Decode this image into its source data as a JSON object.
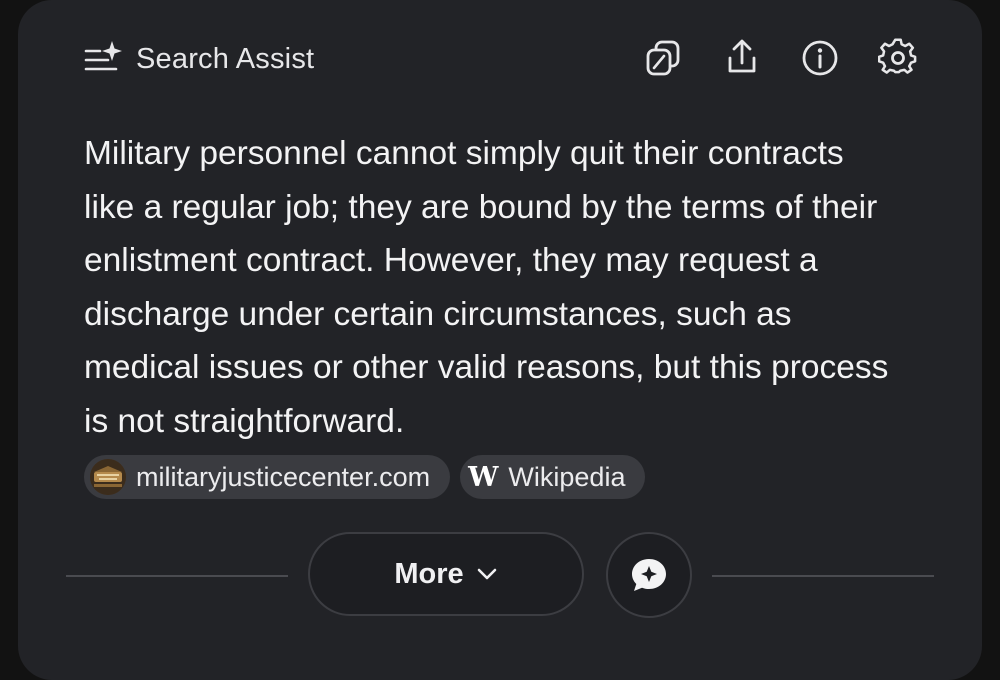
{
  "header": {
    "title": "Search Assist",
    "icons": [
      "sparkle-list-icon",
      "copy-icon",
      "share-icon",
      "info-icon",
      "settings-icon"
    ]
  },
  "answer": {
    "lines": [
      "Military personnel cannot simply quit their contracts",
      "like a regular job; they are bound by the terms of their",
      "enlistment contract. However, they may request a",
      "discharge under certain circumstances, such as",
      "medical issues or other valid reasons, but this process",
      "is not straightforward."
    ]
  },
  "sources": [
    {
      "label": "militaryjusticecenter.com",
      "icon": "military-justice-center-favicon"
    },
    {
      "label": "Wikipedia",
      "icon": "wikipedia-w-icon",
      "logo": "W"
    }
  ],
  "footer": {
    "more_label": "More",
    "chat_icon": "chat-sparkle-icon"
  },
  "colors": {
    "background": "#121212",
    "card": "#222327",
    "chip": "#3a3b40",
    "text": "#f3f3f4"
  }
}
